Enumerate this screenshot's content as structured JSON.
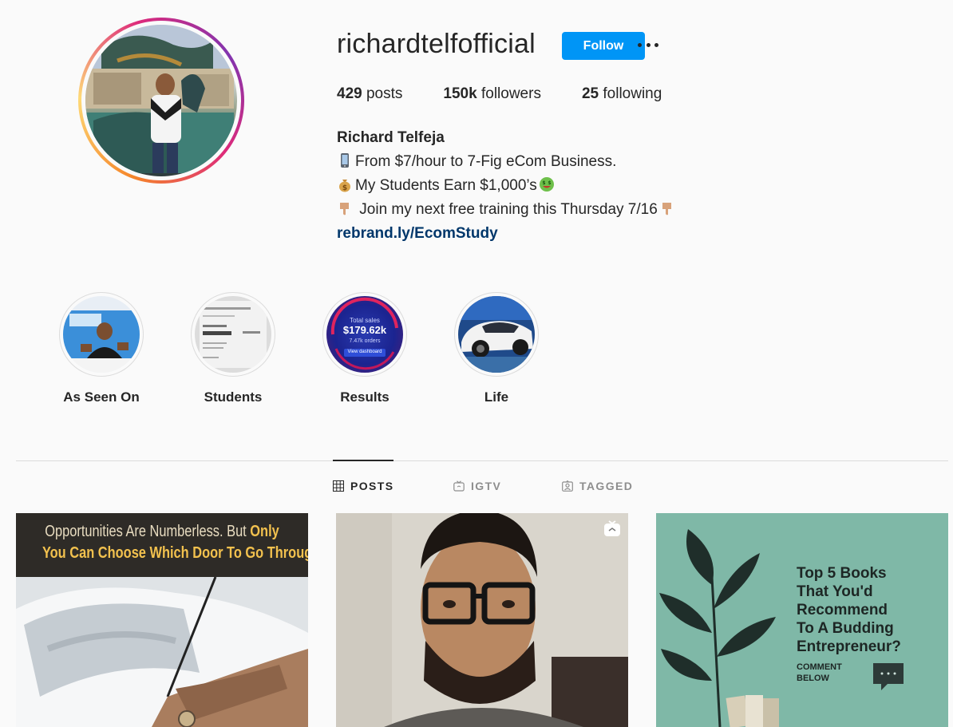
{
  "profile": {
    "username": "richardtelfofficial",
    "follow_label": "Follow",
    "stats": {
      "posts_count": "429",
      "posts_label": "posts",
      "followers_count": "150k",
      "followers_label": "followers",
      "following_count": "25",
      "following_label": "following"
    },
    "bio": {
      "name": "Richard Telfeja",
      "line1": "From $7/hour to 7-Fig eCom Business.",
      "line2": "My Students Earn $1,000’s",
      "line3": " Join my next free training this Thursday 7/16",
      "link": "rebrand.ly/EcomStudy"
    }
  },
  "highlights": [
    {
      "label": "As Seen On"
    },
    {
      "label": "Students"
    },
    {
      "label": "Results"
    },
    {
      "label": "Life"
    }
  ],
  "highlight_results": {
    "total_label": "Total sales",
    "total_value": "$179.62k",
    "orders": "7.47k orders",
    "button": "View dashboard"
  },
  "tabs": [
    {
      "label": "POSTS",
      "active": true
    },
    {
      "label": "IGTV",
      "active": false
    },
    {
      "label": "TAGGED",
      "active": false
    }
  ],
  "posts": [
    {
      "line1": "Opportunities Are Numberless. But ",
      "line1_bold": "Only",
      "line2": "You Can Choose Which Door To Go Through."
    },
    {
      "type": "igtv"
    },
    {
      "lines": [
        "Top 5 Books",
        "That You'd",
        "Recommend",
        "To A Budding",
        "Entrepreneur?"
      ],
      "comment_line1": "COMMENT",
      "comment_line2": "BELOW"
    }
  ],
  "colors": {
    "follow": "#0095f6",
    "link": "#00376b",
    "post3_bg": "#7fb8a7"
  }
}
